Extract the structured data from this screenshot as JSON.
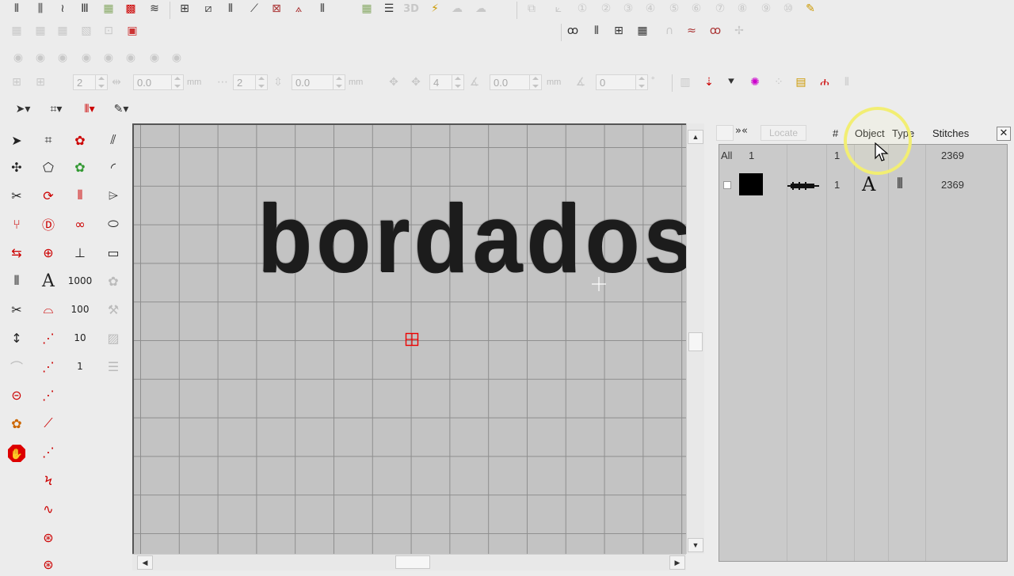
{
  "toolbar": {
    "row1_icons": [
      "satin-stitch-icon",
      "fill-stitch-icon",
      "zigzag-stitch-icon",
      "column-stitch-icon",
      "pattern-fill-icon",
      "cross-fill-icon",
      "wave-fill-icon",
      "grid-fill-icon",
      "diagonal-fill-icon",
      "net-fill-icon",
      "curve-fill-icon",
      "motif-fill-icon",
      "triangle-fill-icon",
      "pillar-fill-icon",
      "pattern-grid-icon",
      "lines-icon",
      "3d-icon",
      "wave-tool-icon",
      "cloud-icon",
      "cloud-outline-icon"
    ],
    "row1_3d_label": "3D",
    "row1_right_icons": [
      "copy-icon",
      "align-1-icon",
      "align-2-icon",
      "align-3-icon",
      "align-4-icon",
      "align-5-icon",
      "align-6-icon",
      "align-7-icon",
      "align-8-icon",
      "align-9-icon",
      "edit-folder-icon"
    ],
    "row2_icons": [
      "wave-grid-icon",
      "pattern-grid-2-icon",
      "net-grid-icon",
      "image-fill-icon",
      "frame-grid-icon",
      "color-grid-icon"
    ],
    "row2_right_icons": [
      "loops-icon",
      "bars-icon",
      "mesh-icon",
      "tiles-icon",
      "arc-icon",
      "zigzag-line-icon",
      "oo-icon",
      "sparkle-icon"
    ],
    "row3_icons": [
      "disabled-1-icon",
      "disabled-2-icon",
      "disabled-3-icon",
      "disabled-4-icon",
      "disabled-5-icon",
      "disabled-6-icon",
      "disabled-7-icon",
      "disabled-8-icon"
    ],
    "spin1_value": "2",
    "spin2_value": "0.0",
    "unit1": "mm",
    "spin3_value": "2",
    "spin4_value": "0.0",
    "unit2": "mm",
    "spin5_value": "4",
    "spin6_value": "0.0",
    "unit3": "mm",
    "spin7_value": "0",
    "unit4": "°",
    "row4_right_icons": [
      "columns-icon",
      "needle-down-icon",
      "needle-icon",
      "color-flower-icon",
      "dots-icon",
      "tool-box-icon",
      "people-icon",
      "stripe-icon"
    ],
    "row5_icons": [
      "select-arrow-dropdown",
      "reshape-dropdown",
      "stitch-type-dropdown",
      "pencil-dropdown"
    ]
  },
  "left_tools": [
    [
      "select-arrow-icon",
      "reshape-nodes-icon",
      "flower-red-icon",
      "diagonal-lines-icon"
    ],
    [
      "node-select-icon",
      "reshape-corner-icon",
      "flower-green-icon",
      "arc-icon"
    ],
    [
      "scissors-select-icon",
      "rotate-icon",
      "satin-red-icon",
      "freehand-icon"
    ],
    [
      "branch-icon",
      "text-column-icon",
      "spring-red-icon",
      "ellipse-icon"
    ],
    [
      "satin-convert-icon",
      "ball-red-icon",
      "pin-red-icon",
      "rectangle-icon"
    ],
    [
      "zigzag-icon",
      "text-A-icon",
      "1000-icon",
      "grey-flower-icon"
    ],
    [
      "scissors-stitch-icon",
      "curve-red-icon",
      "100-icon",
      "grey-tools-icon"
    ],
    [
      "arrows-stitch-icon",
      "dotted-line-icon",
      "10-icon",
      "image-icon"
    ],
    [
      "dotted-arc-icon",
      "dotted-diagonal-icon",
      "1-icon",
      "grey-list-icon"
    ],
    [
      "loop-icon",
      "dash-red-icon",
      "",
      ""
    ],
    [
      "palette-icon",
      "line-red-icon",
      "",
      ""
    ],
    [
      "stop-hand-icon",
      "dash-line-red-icon",
      "",
      ""
    ],
    [
      "",
      "zigzag-node-icon",
      "",
      ""
    ],
    [
      "",
      "s-curve-icon",
      "",
      ""
    ],
    [
      "",
      "ball-stitch-icon",
      "",
      ""
    ],
    [
      "",
      "ball-stitch-2-icon",
      "",
      ""
    ]
  ],
  "tool_labels": {
    "text_A": "A",
    "n1000": "1000",
    "n100": "100",
    "n10": "10",
    "n1": "1"
  },
  "canvas": {
    "embroidered_text": "bordados"
  },
  "panel": {
    "locate_label": "Locate",
    "header_num": "#",
    "header_object": "Object",
    "header_type": "Type",
    "header_stitches": "Stitches",
    "row_all": {
      "label": "All",
      "count": "1",
      "num": "1",
      "stitches": "2369"
    },
    "row_1": {
      "num": "1",
      "type_glyph": "A",
      "stitches": "2369",
      "color": "#000000"
    }
  }
}
